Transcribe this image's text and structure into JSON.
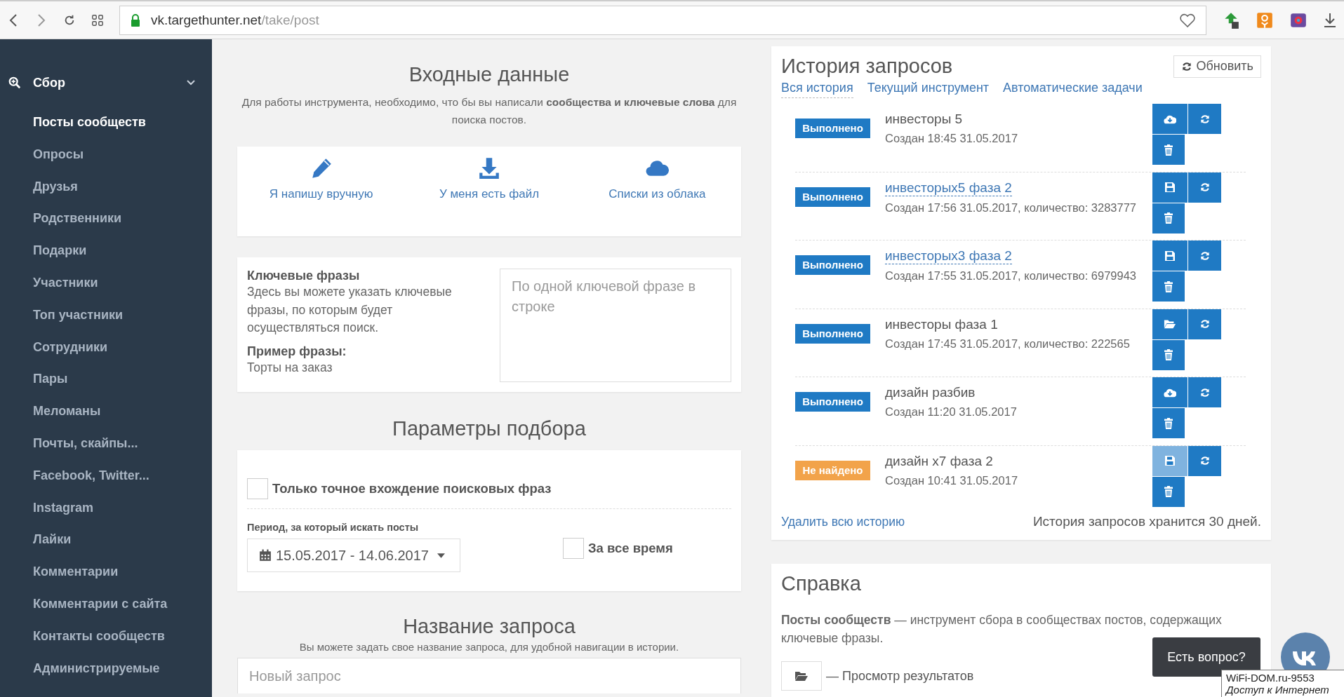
{
  "browser": {
    "url_host": "vk.targethunter.net",
    "url_path": "/take/post"
  },
  "sidebar": {
    "section": {
      "label": "Сбор",
      "expanded": true
    },
    "items": [
      {
        "label": "Посты сообществ",
        "selected": true
      },
      {
        "label": "Опросы",
        "selected": false
      },
      {
        "label": "Друзья",
        "selected": false
      },
      {
        "label": "Родственники",
        "selected": false
      },
      {
        "label": "Подарки",
        "selected": false
      },
      {
        "label": "Участники",
        "selected": false
      },
      {
        "label": "Топ участники",
        "selected": false
      },
      {
        "label": "Сотрудники",
        "selected": false
      },
      {
        "label": "Пары",
        "selected": false
      },
      {
        "label": "Меломаны",
        "selected": false
      },
      {
        "label": "Почты, скайпы...",
        "selected": false
      },
      {
        "label": "Facebook, Twitter...",
        "selected": false
      },
      {
        "label": "Instagram",
        "selected": false
      },
      {
        "label": "Лайки",
        "selected": false
      },
      {
        "label": "Комментарии",
        "selected": false
      },
      {
        "label": "Комментарии с сайта",
        "selected": false
      },
      {
        "label": "Контакты сообществ",
        "selected": false
      },
      {
        "label": "Администрируемые",
        "selected": false
      }
    ]
  },
  "input": {
    "title": "Входные данные",
    "description": "Для работы инструмента, необходимо, что бы вы написали **сообщества и ключевые слова** для поиска постов.",
    "sources": [
      {
        "kind": "pencil",
        "label": "Я напишу вручную"
      },
      {
        "kind": "download",
        "label": "У меня есть файл"
      },
      {
        "kind": "cloud",
        "label": "Списки из облака"
      }
    ],
    "keywords": {
      "title": "Ключевые фразы",
      "description": "Здесь вы можете указать ключевые фразы, по которым будет осуществляться поиск.",
      "example_title": "Пример фразы:",
      "example": "Торты на заказ",
      "placeholder": "По одной ключевой фразе в строке"
    }
  },
  "params": {
    "title": "Параметры подбора",
    "exact_match": {
      "label": "Только точное вхождение поисковых фраз",
      "checked": false
    },
    "period_label": "**Период**, за который искать посты",
    "period": "15.05.2017 - 14.06.2017",
    "all_time": {
      "label": "За все время",
      "checked": false
    }
  },
  "request_name": {
    "title": "Название запроса",
    "description": "Вы можете задать свое название запроса, для удобной навигации в истории.",
    "placeholder": "Новый запрос"
  },
  "history": {
    "title": "История запросов",
    "refresh": "Обновить",
    "tabs": [
      {
        "label": "Вся история",
        "selected": true
      },
      {
        "label": "Текущий инструмент",
        "selected": false
      },
      {
        "label": "Автоматические задачи",
        "selected": false
      }
    ],
    "rows": [
      {
        "status": {
          "kind": "done",
          "label": "Выполнено"
        },
        "title": "инвесторы 5",
        "link": false,
        "subtitle": "Создан 18:45 31.05.2017",
        "file_button": {
          "kind": "cloud",
          "disabled": false
        }
      },
      {
        "status": {
          "kind": "done",
          "label": "Выполнено"
        },
        "title": "инвесторых5 фаза 2",
        "link": true,
        "subtitle": "Создан 17:56 31.05.2017, количество: 3283777",
        "file_button": {
          "kind": "save",
          "disabled": false
        }
      },
      {
        "status": {
          "kind": "done",
          "label": "Выполнено"
        },
        "title": "инвесторых3 фаза 2",
        "link": true,
        "subtitle": "Создан 17:55 31.05.2017, количество: 6979943",
        "file_button": {
          "kind": "save",
          "disabled": false
        }
      },
      {
        "status": {
          "kind": "done",
          "label": "Выполнено"
        },
        "title": "инвесторы фаза 1",
        "link": false,
        "subtitle": "Создан 17:45 31.05.2017, количество: 222565",
        "file_button": {
          "kind": "folder",
          "disabled": false
        }
      },
      {
        "status": {
          "kind": "done",
          "label": "Выполнено"
        },
        "title": "дизайн разбив",
        "link": false,
        "subtitle": "Создан 11:20 31.05.2017",
        "file_button": {
          "kind": "cloud",
          "disabled": false
        }
      },
      {
        "status": {
          "kind": "not_found",
          "label": "Не найдено"
        },
        "title": "дизайн x7 фаза 2",
        "link": false,
        "subtitle": "Создан 10:41 31.05.2017",
        "file_button": {
          "kind": "save",
          "disabled": true
        }
      }
    ],
    "delete_all": "Удалить всю историю",
    "note": "История запросов хранится 30 дней."
  },
  "help": {
    "title": "Справка",
    "text": "**Посты сообществ** — инструмент сбора в сообществах постов, содержащих ключевые фразы.",
    "legend": "— Просмотр результатов"
  },
  "chat": {
    "label": "Есть вопрос?"
  },
  "system_tooltip": {
    "title": "WiFi-DOM.ru-9553",
    "subtitle": "Доступ к Интернет"
  }
}
